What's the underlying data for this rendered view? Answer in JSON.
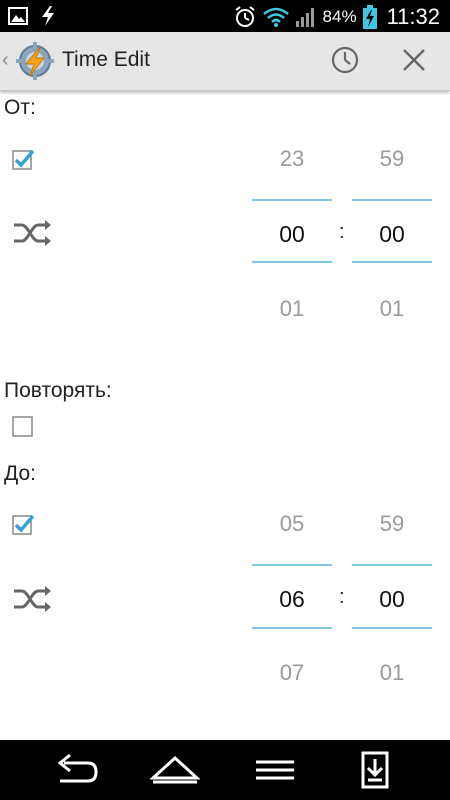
{
  "status_bar": {
    "icons": [
      "image-icon",
      "flash-icon",
      "alarm-icon",
      "wifi-icon",
      "signal-icon",
      "battery-charging-icon"
    ],
    "battery": "84%",
    "time": "11:32"
  },
  "action_bar": {
    "title": "Time Edit",
    "icons": [
      "back-chevron-icon",
      "tasker-logo-icon",
      "clock-icon",
      "close-icon"
    ]
  },
  "from": {
    "label": "От:",
    "enabled": true,
    "hours": {
      "prev": "23",
      "current": "00",
      "next": "01"
    },
    "minutes": {
      "prev": "59",
      "current": "00",
      "next": "01"
    },
    "separator": ":"
  },
  "repeat": {
    "label": "Повторять:",
    "enabled": false
  },
  "to": {
    "label": "До:",
    "enabled": true,
    "hours": {
      "prev": "05",
      "current": "06",
      "next": "07"
    },
    "minutes": {
      "prev": "59",
      "current": "00",
      "next": "01"
    },
    "separator": ":"
  },
  "nav_bar": {
    "icons": [
      "back-icon",
      "home-icon",
      "menu-icon",
      "download-icon"
    ]
  },
  "colors": {
    "accent": "#7ec6e3",
    "check": "#33a3d4",
    "status_bar": "#000000",
    "action_bar": "#e6e6e6"
  }
}
